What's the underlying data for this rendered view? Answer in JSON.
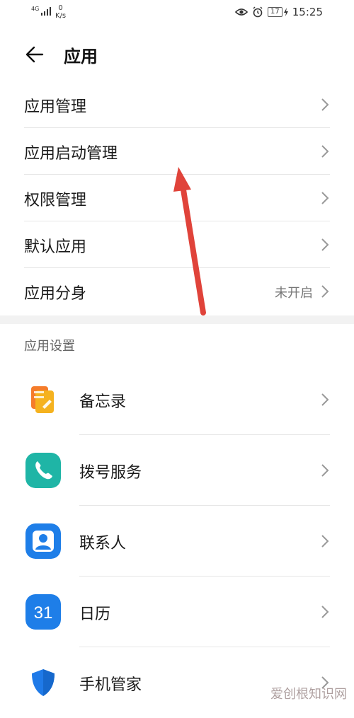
{
  "status_bar": {
    "network_type": "4G",
    "speed_value": "0",
    "speed_unit": "K/s",
    "battery_level": "17",
    "time": "15:25",
    "icons": [
      "eye-icon",
      "alarm-icon",
      "battery-icon",
      "charging-icon",
      "signal-icon"
    ]
  },
  "header": {
    "title": "应用",
    "back_icon": "arrow-left-icon"
  },
  "menu_items": [
    {
      "label": "应用管理",
      "value": ""
    },
    {
      "label": "应用启动管理",
      "value": ""
    },
    {
      "label": "权限管理",
      "value": ""
    },
    {
      "label": "默认应用",
      "value": ""
    },
    {
      "label": "应用分身",
      "value": "未开启"
    }
  ],
  "section": {
    "title": "应用设置"
  },
  "app_settings": [
    {
      "label": "备忘录",
      "icon": "notes-icon"
    },
    {
      "label": "拨号服务",
      "icon": "phone-icon"
    },
    {
      "label": "联系人",
      "icon": "contacts-icon"
    },
    {
      "label": "日历",
      "icon": "calendar-icon",
      "icon_text": "31"
    },
    {
      "label": "手机管家",
      "icon": "shield-icon"
    }
  ],
  "watermark": "爱创根知识网",
  "colors": {
    "annotation_arrow": "#e0433a",
    "notes_icon": "#f5a623",
    "phone_icon": "#1fb5a6",
    "contacts_icon": "#1e7ee8",
    "calendar_icon": "#1e7ee8",
    "shield_icon": "#1f7ae8"
  }
}
